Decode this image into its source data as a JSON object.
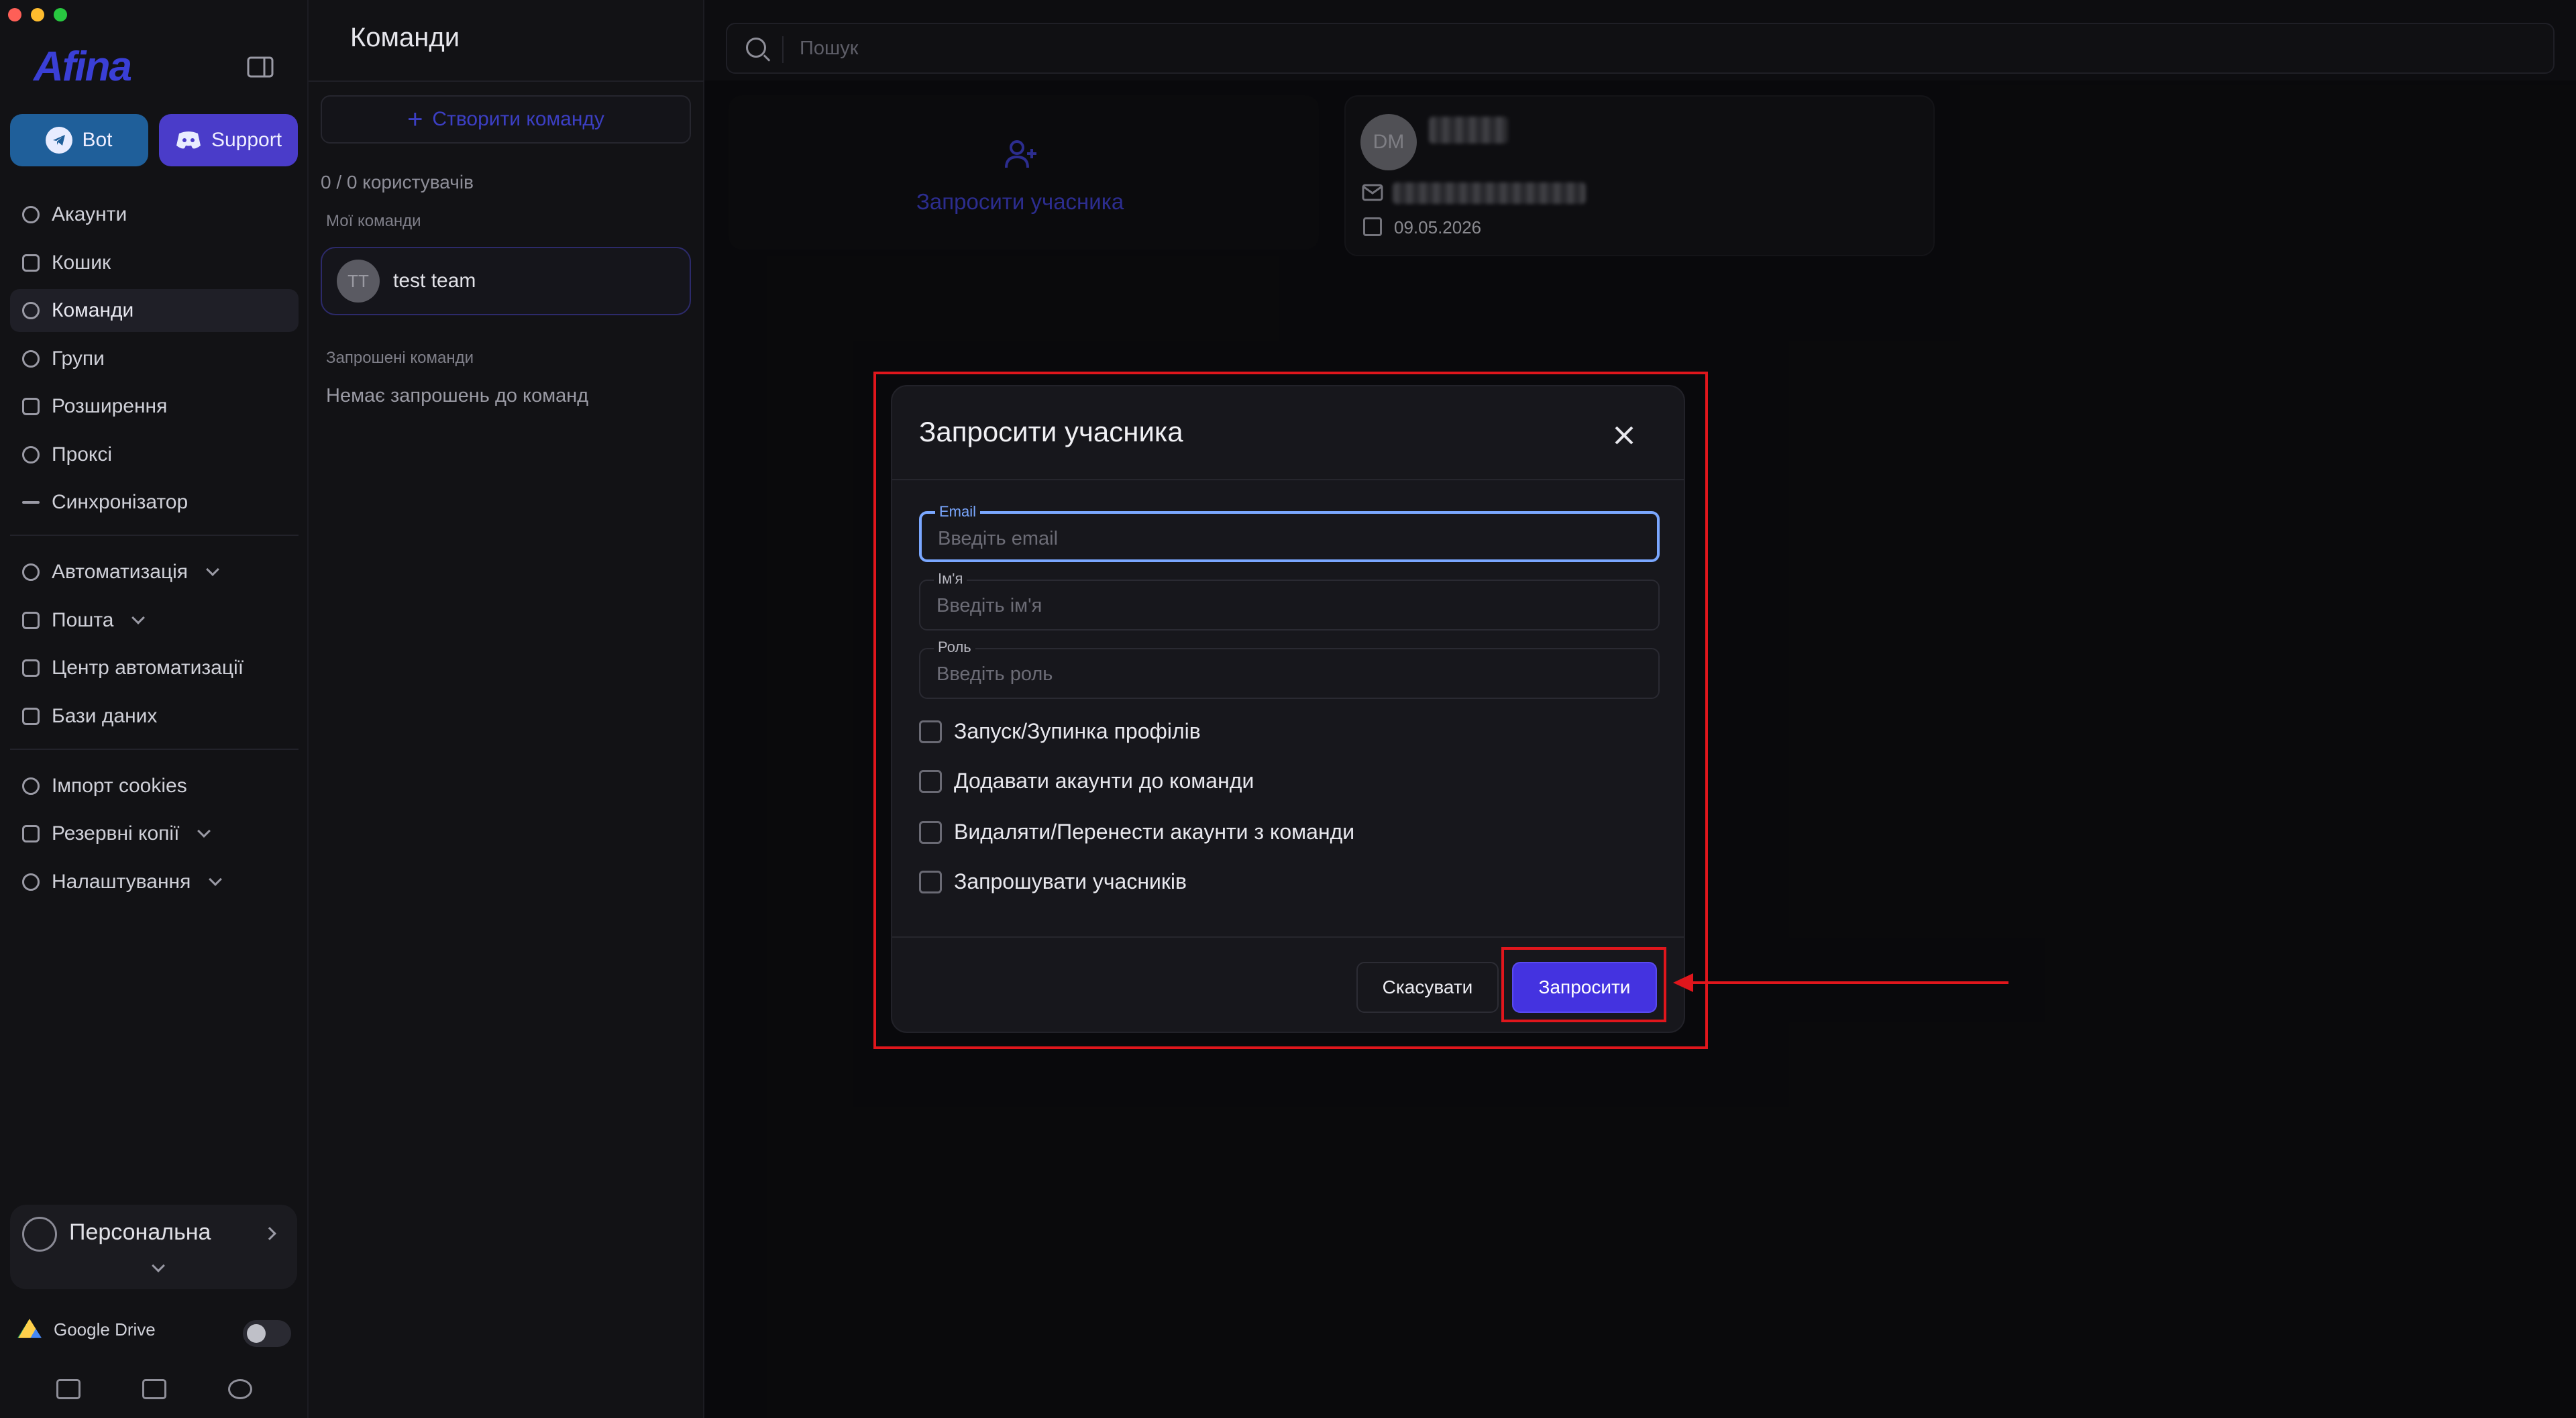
{
  "sidebar": {
    "logo": "Afina",
    "bot_label": "Bot",
    "support_label": "Support",
    "items": [
      {
        "label": "Акаунти"
      },
      {
        "label": "Кошик"
      },
      {
        "label": "Команди"
      },
      {
        "label": "Групи"
      },
      {
        "label": "Розширення"
      },
      {
        "label": "Проксі"
      },
      {
        "label": "Синхронізатор"
      },
      {
        "label": "Автоматизація"
      },
      {
        "label": "Пошта"
      },
      {
        "label": "Центр автоматизації"
      },
      {
        "label": "Бази даних"
      },
      {
        "label": "Імпорт cookies"
      },
      {
        "label": "Резервні копії"
      },
      {
        "label": "Налаштування"
      }
    ],
    "profile_label": "Персональна",
    "gdrive_label": "Google Drive"
  },
  "teams": {
    "title": "Команди",
    "create_label": "Створити команду",
    "count": "0 / 0 користувачів",
    "my_teams_label": "Мої команди",
    "team_avatar": "TT",
    "team_name": "test team",
    "invited_label": "Запрошені команди",
    "no_invites": "Немає запрошень до команд"
  },
  "main": {
    "search_placeholder": "Пошук",
    "invite_member_label": "Запросити учасника",
    "member_initials": "DM",
    "member_date": "09.05.2026"
  },
  "dialog": {
    "title": "Запросити учасника",
    "email_label": "Email",
    "email_placeholder": "Введіть email",
    "name_label": "Ім'я",
    "name_placeholder": "Введіть ім'я",
    "role_label": "Роль",
    "role_placeholder": "Введіть роль",
    "permissions": [
      {
        "label": "Запуск/Зупинка профілів"
      },
      {
        "label": "Додавати акаунти до команди"
      },
      {
        "label": "Видаляти/Перенести акаунти з команди"
      },
      {
        "label": "Запрошувати учасників"
      }
    ],
    "cancel_label": "Скасувати",
    "submit_label": "Запросити"
  },
  "colors": {
    "accent": "#4433e0",
    "highlight": "#e0161c",
    "bot_button": "#1f5f9a",
    "support_button": "#4a3cc9",
    "focus_border": "#7aa7ff"
  }
}
